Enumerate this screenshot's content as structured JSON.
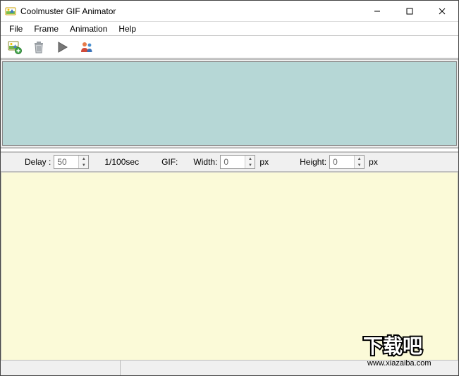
{
  "window": {
    "title": "Coolmuster GIF Animator"
  },
  "menu": {
    "file": "File",
    "frame": "Frame",
    "animation": "Animation",
    "help": "Help"
  },
  "toolbar": {
    "add_image": "add-image",
    "delete": "delete",
    "play": "play",
    "people": "people"
  },
  "settings": {
    "delay_label": "Delay :",
    "delay_value": "50",
    "delay_unit": "1/100sec",
    "gif_label": "GIF:",
    "width_label": "Width:",
    "width_value": "0",
    "width_unit": "px",
    "height_label": "Height:",
    "height_value": "0",
    "height_unit": "px"
  },
  "watermark": {
    "text": "下载吧",
    "url": "www.xiazaiba.com"
  }
}
